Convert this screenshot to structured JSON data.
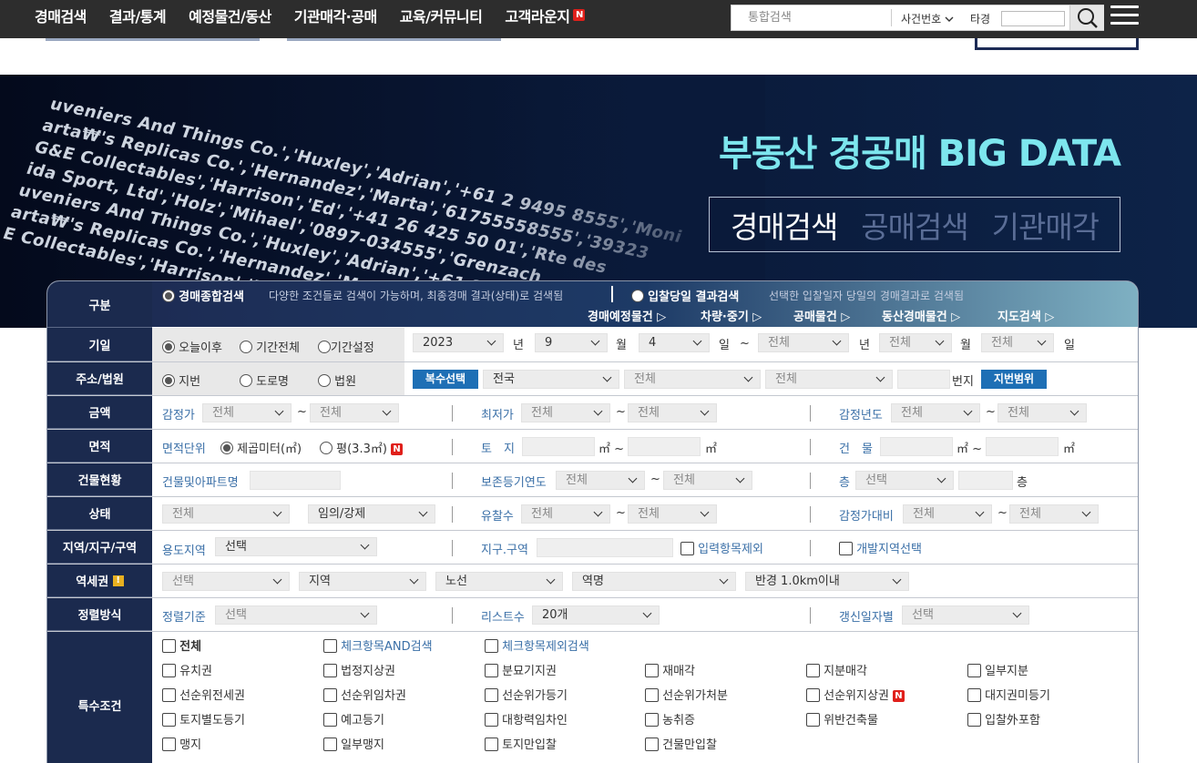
{
  "nav": {
    "menu": [
      "경매검색",
      "결과/통계",
      "예정물건/동산",
      "기관매각·공매",
      "교육/커뮤니티",
      "고객라운지"
    ],
    "new_badge": "N",
    "search_placeholder": "통합검색",
    "case_select": "사건번호",
    "other_label": "타경"
  },
  "hero": {
    "bg_lines": [
      "uveniers And Things Co.','Huxley','Adrian','+61 2 9495 8555','Moni",
      "arta₩'s Replicas Co.','Hernandez','Marta','61755558555','39323",
      "G&E Collectables','Harrison','Ed','+41 26 425 50 01','Rte des",
      "ida Sport, Ltd','Holz','Mihael','0897-034555','Grenzach",
      "uveniers And Things Co.','Huxley','Adrian','+61 2 9495 8555','Moni",
      "arta₩'s Replicas Co.','Hernandez','Marta','61755558555','39323",
      "E Collectables','Harrison','Ed','+41 26 425 50 01','Rte des"
    ],
    "title": "부동산 경공매 BIG DATA",
    "tabs": [
      "경매검색",
      "공매검색",
      "기관매각"
    ]
  },
  "form": {
    "gubun": {
      "label": "구분",
      "opt1": "경매종합검색",
      "opt1_desc": "다양한 조건들로 검색이 가능하며, 최종경매 결과(상태)로 검색됨",
      "opt2": "입찰당일 결과검색",
      "opt2_desc": "선택한 입찰일자 당일의 경매결과로 검색됨",
      "links": [
        "경매예정물건 ▷",
        "차량·중기 ▷",
        "공매물건 ▷",
        "동산경매물건 ▷",
        "지도검색 ▷"
      ]
    },
    "date": {
      "label": "기일",
      "opts": [
        "오늘이후",
        "기간전체",
        "기간설정"
      ],
      "year": "2023",
      "year_unit": "년",
      "month": "9",
      "month_unit": "월",
      "day": "4",
      "day_unit": "일",
      "tilde": "~",
      "end_all": "전체"
    },
    "addr": {
      "label": "주소/법원",
      "opts": [
        "지번",
        "도로명",
        "법원"
      ],
      "multi_btn": "복수선택",
      "sido": "전국",
      "all": "전체",
      "bunji": "번지",
      "range_btn": "지번범위"
    },
    "amount": {
      "label": "금액",
      "appraisal": "감정가",
      "min_price": "최저가",
      "appraisal_year": "감정년도",
      "all": "전체",
      "tilde": "~"
    },
    "area": {
      "label": "면적",
      "unit_label": "면적단위",
      "unit_sqm": "제곱미터(㎡)",
      "unit_pyeong": "평(3.3㎡)",
      "land": "토　지",
      "building": "건　물",
      "sqm": "㎡",
      "tilde": "~"
    },
    "bldg": {
      "label": "건물현황",
      "name_label": "건물및아파트명",
      "reg_year": "보존등기연도",
      "floor": "층",
      "select": "선택",
      "all": "전체",
      "floor_unit": "층",
      "tilde": "~"
    },
    "status": {
      "label": "상태",
      "all": "전체",
      "type": "임의/강제",
      "fail_count": "유찰수",
      "ratio": "감정가대비",
      "tilde": "~"
    },
    "zone": {
      "label": "지역/지구/구역",
      "use_zone": "용도지역",
      "select": "선택",
      "district": "지구.구역",
      "exclude": "입력항목제외",
      "dev_zone": "개발지역선택"
    },
    "station": {
      "label": "역세권",
      "warn": "!",
      "select": "선택",
      "region": "지역",
      "line": "노선",
      "station": "역명",
      "radius": "반경 1.0km이내"
    },
    "sort": {
      "label": "정렬방식",
      "criteria": "정렬기준",
      "select": "선택",
      "list_count": "리스트수",
      "count_val": "20개",
      "updated": "갱신일자별"
    },
    "special": {
      "label": "특수조건",
      "all": "전체",
      "and_search": "체크항목AND검색",
      "exclude_search": "체크항목제외검색",
      "items": [
        [
          "유치권",
          "법정지상권",
          "분묘기지권",
          "재매각",
          "지분매각",
          "일부지분"
        ],
        [
          "선순위전세권",
          "선순위임차권",
          "선순위가등기",
          "선순위가처분",
          "선순위지상권",
          "대지권미등기"
        ],
        [
          "토지별도등기",
          "예고등기",
          "대항력임차인",
          "농취증",
          "위반건축물",
          "입찰外포함"
        ],
        [
          "맹지",
          "일부맹지",
          "토지만입찰",
          "건물만입찰"
        ]
      ]
    }
  }
}
